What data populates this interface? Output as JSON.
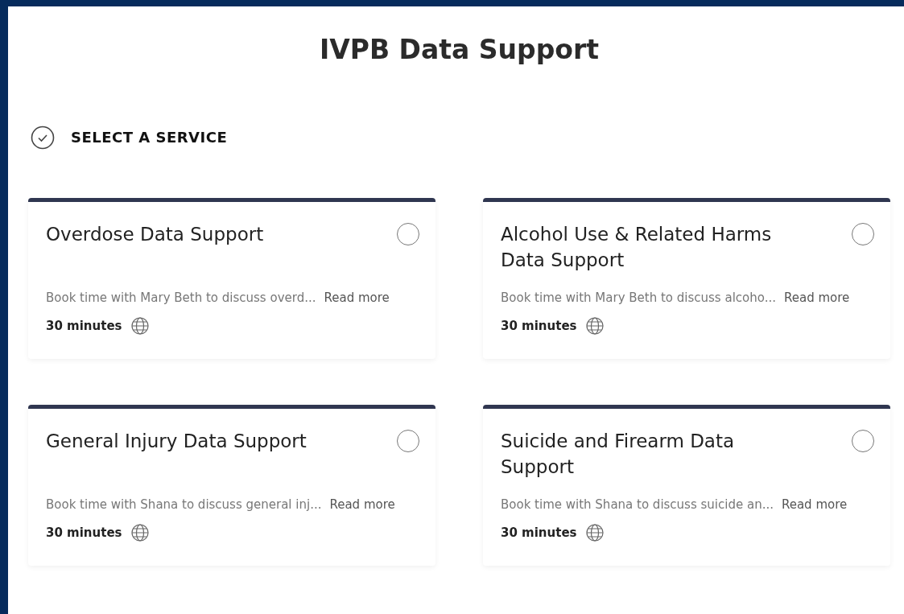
{
  "page": {
    "title": "IVPB Data Support"
  },
  "step": {
    "label": "SELECT A SERVICE"
  },
  "services": [
    {
      "title": "Overdose Data Support",
      "selected": false,
      "description": "Book time with Mary Beth to discuss overd...",
      "link": "Read more",
      "duration": "30 minutes"
    },
    {
      "title": "Alcohol Use & Related Harms Data Support",
      "selected": false,
      "description": "Book time with Mary Beth to discuss alcoho...",
      "link": "Read more",
      "duration": "30 minutes"
    },
    {
      "title": "General Injury Data Support",
      "selected": false,
      "description": "Book time with Shana to discuss general inj...",
      "link": "Read more",
      "duration": "30 minutes"
    },
    {
      "title": "Suicide and Firearm Data Support",
      "selected": false,
      "description": "Book time with Shana to discuss suicide an...",
      "link": "Read more",
      "duration": "30 minutes"
    }
  ]
}
